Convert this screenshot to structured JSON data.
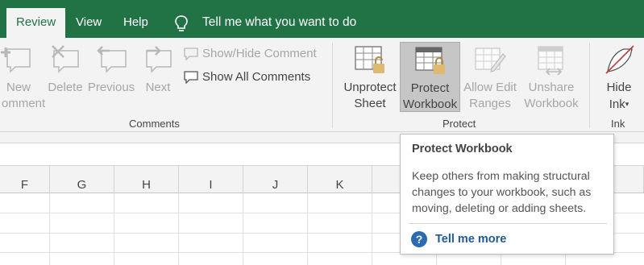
{
  "tabs": [
    {
      "label": "Review",
      "active": true
    },
    {
      "label": "View",
      "active": false
    },
    {
      "label": "Help",
      "active": false
    }
  ],
  "tell_me": {
    "label": "Tell me what you want to do",
    "icon": "lightbulb-icon"
  },
  "colors": {
    "brand": "#217346",
    "ribbon_bg": "#f3f3f3",
    "disabled_text": "#a6a6a6",
    "link": "#1e5a96"
  },
  "comments_group": {
    "label": "Comments",
    "new_comment": {
      "line1": "New",
      "line2": "omment"
    },
    "delete": "Delete",
    "previous": "Previous",
    "next": "Next",
    "show_hide": "Show/Hide Comment",
    "show_all": "Show All Comments"
  },
  "protect_group": {
    "label": "Protect",
    "unprotect_sheet": {
      "line1": "Unprotect",
      "line2": "Sheet"
    },
    "protect_workbook": {
      "line1": "Protect",
      "line2": "Workbook"
    },
    "allow_edit_ranges": {
      "line1": "Allow Edit",
      "line2": "Ranges"
    },
    "unshare_workbook": {
      "line1": "Unshare",
      "line2": "Workbook"
    }
  },
  "ink_group": {
    "label": "Ink",
    "hide_ink": {
      "line1": "Hide",
      "line2": "Ink"
    }
  },
  "columns": [
    "F",
    "G",
    "H",
    "I",
    "J",
    "K"
  ],
  "tooltip": {
    "title": "Protect Workbook",
    "description": "Keep others from making structural changes to your workbook, such as moving, deleting or adding sheets.",
    "link": "Tell me more"
  }
}
